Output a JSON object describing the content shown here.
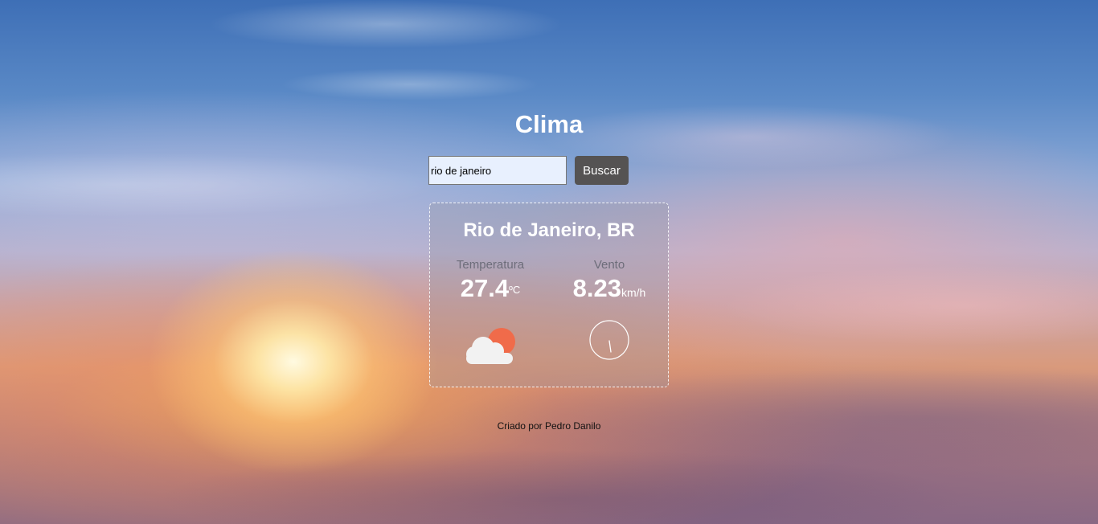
{
  "app": {
    "title": "Clima"
  },
  "search": {
    "value": "rio de janeiro",
    "button_label": "Buscar"
  },
  "weather": {
    "city": "Rio de Janeiro, BR",
    "temperature": {
      "label": "Temperatura",
      "value": "27.4",
      "unit": "ºC"
    },
    "wind": {
      "label": "Vento",
      "value": "8.23",
      "unit": "km/h"
    },
    "icon": "partly-cloudy-icon",
    "wind_direction_icon": "wind-direction-compass-icon"
  },
  "footer": {
    "credit": "Criado por Pedro Danilo"
  },
  "colors": {
    "button_bg": "#555353",
    "input_bg": "#e8f0fe",
    "sun": "#f06b4a",
    "cloud": "#f2f2f2"
  }
}
